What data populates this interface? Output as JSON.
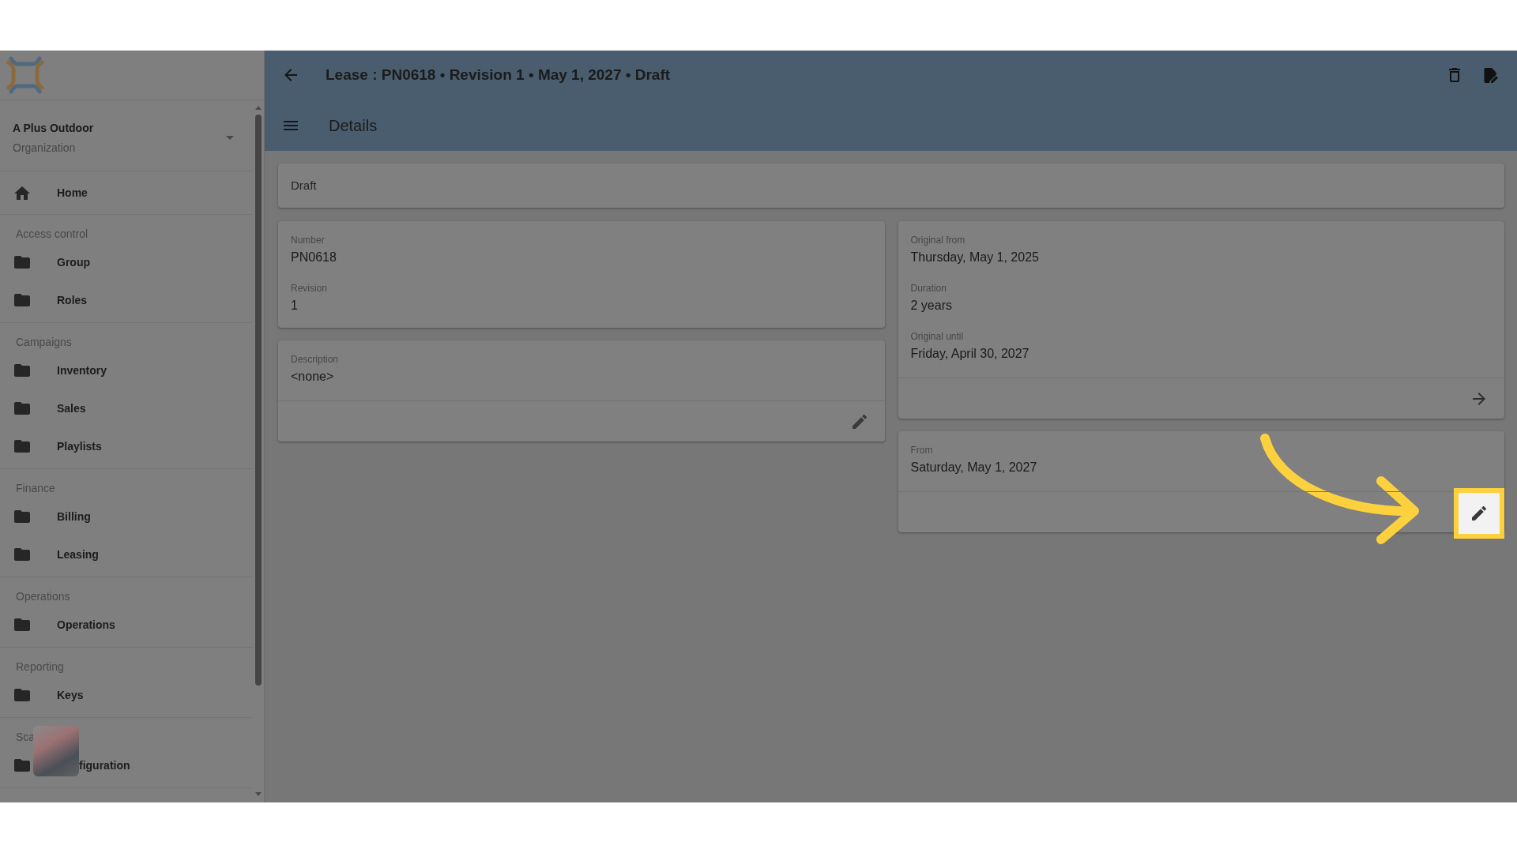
{
  "sidebar": {
    "organization": {
      "name": "A Plus Outdoor",
      "type": "Organization"
    },
    "sections": [
      {
        "obscured": false,
        "items": [
          {
            "kind": "home",
            "label": "Home"
          }
        ]
      },
      {
        "title": "Access control",
        "obscured": false,
        "items": [
          {
            "kind": "folder",
            "label": "Group"
          },
          {
            "kind": "folder",
            "label": "Roles"
          }
        ]
      },
      {
        "title": "Campaigns",
        "obscured": false,
        "items": [
          {
            "kind": "folder",
            "label": "Inventory"
          },
          {
            "kind": "folder",
            "label": "Sales"
          },
          {
            "kind": "folder",
            "label": "Playlists"
          }
        ]
      },
      {
        "title": "Finance",
        "obscured": false,
        "items": [
          {
            "kind": "folder",
            "label": "Billing"
          },
          {
            "kind": "folder",
            "label": "Leasing"
          }
        ]
      },
      {
        "title": "Operations",
        "obscured": false,
        "items": [
          {
            "kind": "folder",
            "label": "Operations"
          }
        ]
      },
      {
        "title": "Reporting",
        "obscured": false,
        "items": [
          {
            "kind": "folder",
            "label": "Keys"
          }
        ]
      },
      {
        "title": "Sca",
        "obscured": true,
        "items": [
          {
            "kind": "folder",
            "label": "figuration"
          }
        ]
      }
    ]
  },
  "header": {
    "title": "Lease : PN0618 • Revision 1 • May 1, 2027 • Draft",
    "subtitle": "Details"
  },
  "content": {
    "status": "Draft",
    "columns": [
      {
        "cards": [
          {
            "fields": [
              {
                "label": "Number",
                "value": "PN0618"
              },
              {
                "label": "Revision",
                "value": "1"
              }
            ]
          },
          {
            "fields": [
              {
                "label": "Description",
                "value": "<none>"
              }
            ],
            "footer": {
              "kind": "edit",
              "highlighted": false
            }
          }
        ]
      },
      {
        "cards": [
          {
            "fields": [
              {
                "label": "Original from",
                "value": "Thursday, May 1, 2025"
              },
              {
                "label": "Duration",
                "value": "2 years"
              },
              {
                "label": "Original until",
                "value": "Friday, April 30, 2027"
              }
            ],
            "footer": {
              "kind": "forward",
              "highlighted": false
            }
          },
          {
            "fields": [
              {
                "label": "From",
                "value": "Saturday, May 1, 2027"
              }
            ],
            "footer": {
              "kind": "edit",
              "highlighted": true
            }
          }
        ]
      }
    ]
  }
}
